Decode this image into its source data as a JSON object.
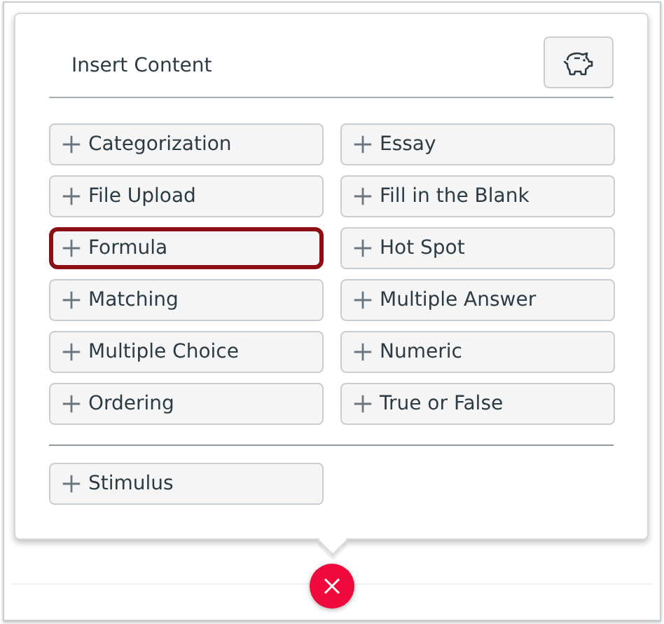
{
  "popover": {
    "title": "Insert Content",
    "items": [
      {
        "label": "Categorization",
        "selected": false
      },
      {
        "label": "Essay",
        "selected": false
      },
      {
        "label": "File Upload",
        "selected": false
      },
      {
        "label": "Fill in the Blank",
        "selected": false
      },
      {
        "label": "Formula",
        "selected": true
      },
      {
        "label": "Hot Spot",
        "selected": false
      },
      {
        "label": "Matching",
        "selected": false
      },
      {
        "label": "Multiple Answer",
        "selected": false
      },
      {
        "label": "Multiple Choice",
        "selected": false
      },
      {
        "label": "Numeric",
        "selected": false
      },
      {
        "label": "Ordering",
        "selected": false
      },
      {
        "label": "True or False",
        "selected": false
      }
    ],
    "extra_items": [
      {
        "label": "Stimulus",
        "selected": false
      }
    ]
  }
}
